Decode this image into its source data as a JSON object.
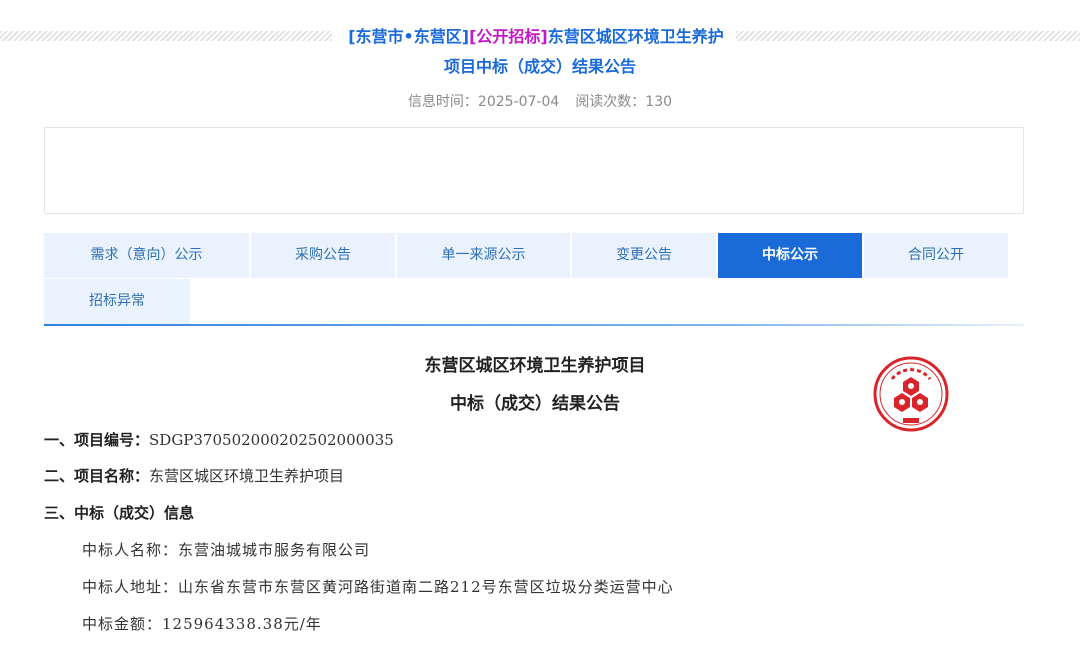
{
  "header": {
    "title_prefix_region": "[东营市•东营区]",
    "title_prefix_type": "[公开招标]",
    "title_line1_rest": "东营区城区环境卫生养护",
    "title_line2": "项目中标（成交）结果公告",
    "info_time": "信息时间：2025-07-04",
    "read_count": "阅读次数：130"
  },
  "tabs": [
    {
      "label": "需求（意向）公示",
      "active": false
    },
    {
      "label": "采购公告",
      "active": false
    },
    {
      "label": "单一来源公示",
      "active": false
    },
    {
      "label": "变更公告",
      "active": false
    },
    {
      "label": "中标公示",
      "active": true
    },
    {
      "label": "合同公开",
      "active": false
    },
    {
      "label": "招标异常",
      "active": false
    }
  ],
  "document": {
    "title1": "东营区城区环境卫生养护项目",
    "title2": "中标（成交）结果公告",
    "project_no_label": "一、项目编号：",
    "project_no_value": "SDGP370502000202502000035",
    "project_name_label": "二、项目名称：",
    "project_name_value": "东营区城区环境卫生养护项目",
    "winning_info_label": "三、中标（成交）信息",
    "winner_name": "中标人名称：东营油城城市服务有限公司",
    "winner_address": "中标人地址：山东省东营市东营区黄河路街道南二路212号东营区垃圾分类运营中心",
    "winner_amount": "中标金额：125964338.38元/年"
  },
  "colors": {
    "accent_blue": "#1a6ad8",
    "magenta": "#c418c8",
    "tab_bg": "#eaf3fd",
    "seal_red": "#d8252b"
  }
}
